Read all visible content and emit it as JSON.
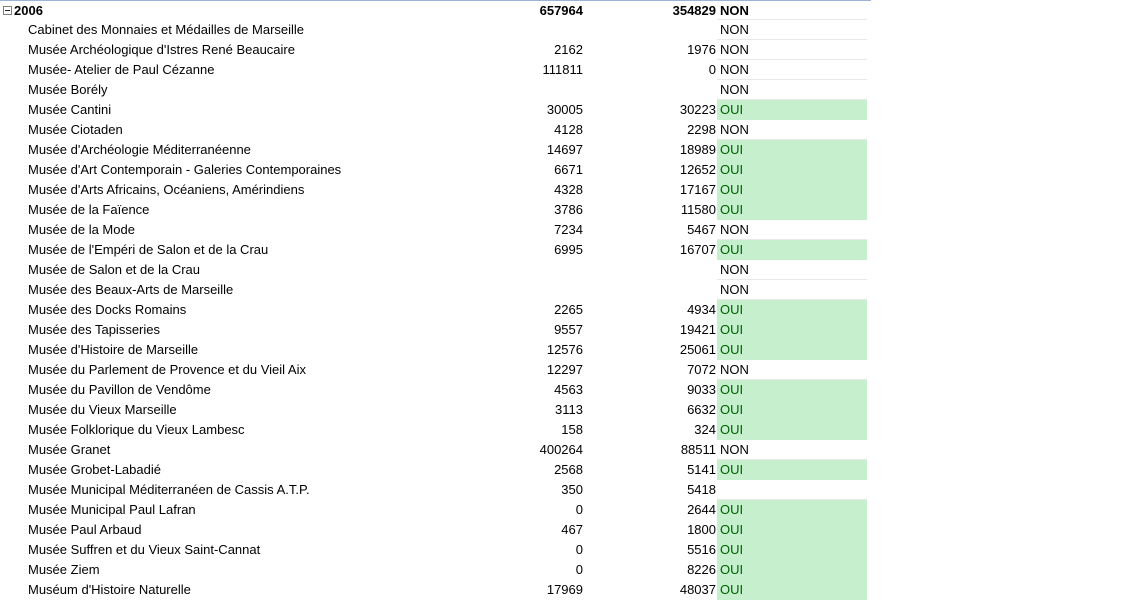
{
  "pivot": {
    "year_row": {
      "label": "2006",
      "value1": "657964",
      "value2": "354829",
      "flag": "NON"
    },
    "rows": [
      {
        "name": "Cabinet des Monnaies et Médailles de Marseille",
        "value1": "",
        "value2": "",
        "flag": "NON"
      },
      {
        "name": "Musée Archéologique d'Istres René Beaucaire",
        "value1": "2162",
        "value2": "1976",
        "flag": "NON"
      },
      {
        "name": "Musée- Atelier de Paul Cézanne",
        "value1": "111811",
        "value2": "0",
        "flag": "NON"
      },
      {
        "name": "Musée Borély",
        "value1": "",
        "value2": "",
        "flag": "NON"
      },
      {
        "name": "Musée Cantini",
        "value1": "30005",
        "value2": "30223",
        "flag": "OUI"
      },
      {
        "name": "Musée Ciotaden",
        "value1": "4128",
        "value2": "2298",
        "flag": "NON"
      },
      {
        "name": "Musée d'Archéologie Méditerranéenne",
        "value1": "14697",
        "value2": "18989",
        "flag": "OUI"
      },
      {
        "name": "Musée d'Art Contemporain - Galeries Contemporaines",
        "value1": "6671",
        "value2": "12652",
        "flag": "OUI"
      },
      {
        "name": "Musée d'Arts Africains, Océaniens, Amérindiens",
        "value1": "4328",
        "value2": "17167",
        "flag": "OUI"
      },
      {
        "name": "Musée de la Faïence",
        "value1": "3786",
        "value2": "11580",
        "flag": "OUI"
      },
      {
        "name": "Musée de la Mode",
        "value1": "7234",
        "value2": "5467",
        "flag": "NON"
      },
      {
        "name": "Musée de l'Empéri de Salon et de la Crau",
        "value1": "6995",
        "value2": "16707",
        "flag": "OUI"
      },
      {
        "name": "Musée de Salon et de la Crau",
        "value1": "",
        "value2": "",
        "flag": "NON"
      },
      {
        "name": "Musée des Beaux-Arts de Marseille",
        "value1": "",
        "value2": "",
        "flag": "NON"
      },
      {
        "name": "Musée des Docks Romains",
        "value1": "2265",
        "value2": "4934",
        "flag": "OUI"
      },
      {
        "name": "Musée des Tapisseries",
        "value1": "9557",
        "value2": "19421",
        "flag": "OUI"
      },
      {
        "name": "Musée d'Histoire de Marseille",
        "value1": "12576",
        "value2": "25061",
        "flag": "OUI"
      },
      {
        "name": "Musée du Parlement de Provence et du Vieil Aix",
        "value1": "12297",
        "value2": "7072",
        "flag": "NON"
      },
      {
        "name": "Musée du Pavillon de Vendôme",
        "value1": "4563",
        "value2": "9033",
        "flag": "OUI"
      },
      {
        "name": "Musée du Vieux Marseille",
        "value1": "3113",
        "value2": "6632",
        "flag": "OUI"
      },
      {
        "name": "Musée Folklorique du Vieux Lambesc",
        "value1": "158",
        "value2": "324",
        "flag": "OUI"
      },
      {
        "name": "Musée Granet",
        "value1": "400264",
        "value2": "88511",
        "flag": "NON"
      },
      {
        "name": "Musée Grobet-Labadié",
        "value1": "2568",
        "value2": "5141",
        "flag": "OUI"
      },
      {
        "name": "Musée Municipal Méditerranéen de Cassis A.T.P.",
        "value1": "350",
        "value2": "5418",
        "flag": ""
      },
      {
        "name": "Musée Municipal Paul Lafran",
        "value1": "0",
        "value2": "2644",
        "flag": "OUI"
      },
      {
        "name": "Musée Paul Arbaud",
        "value1": "467",
        "value2": "1800",
        "flag": "OUI"
      },
      {
        "name": "Musée Suffren et du Vieux Saint-Cannat",
        "value1": "0",
        "value2": "5516",
        "flag": "OUI"
      },
      {
        "name": "Musée Ziem",
        "value1": "0",
        "value2": "8226",
        "flag": "OUI"
      },
      {
        "name": "Muséum d'Histoire Naturelle",
        "value1": "17969",
        "value2": "48037",
        "flag": "OUI"
      }
    ]
  },
  "colors": {
    "oui_fill": "#c6efce",
    "oui_text": "#006100",
    "header_border": "#9bb3d8"
  },
  "icons": {
    "collapse": "collapse-minus-icon"
  }
}
